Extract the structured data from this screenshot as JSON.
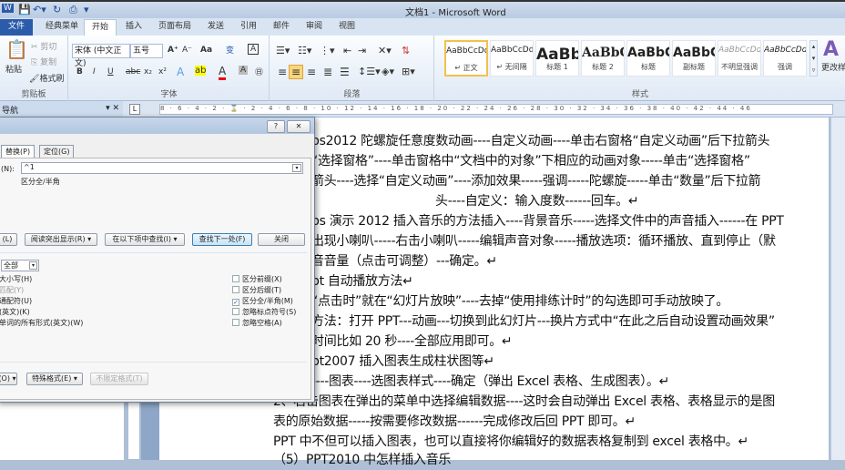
{
  "window": {
    "title": "文档1 - Microsoft Word"
  },
  "ribbon_tabs": [
    "文件",
    "经典菜单",
    "开始",
    "插入",
    "页面布局",
    "发送",
    "引用",
    "邮件",
    "审阅",
    "视图"
  ],
  "active_tab": "开始",
  "clipboard": {
    "paste": "粘贴",
    "cut": "剪切",
    "copy": "复制",
    "format_painter": "格式刷",
    "label": "剪贴板"
  },
  "font": {
    "name": "宋体 (中文正文)",
    "size": "五号",
    "label": "字体",
    "bold": "B",
    "italic": "I",
    "underline": "U",
    "strike": "abc",
    "sub": "x₂",
    "sup": "x²",
    "grow": "A⁺",
    "shrink": "A⁻",
    "case": "Aa"
  },
  "paragraph": {
    "label": "段落"
  },
  "styles": {
    "label": "样式",
    "change": "更改样式",
    "items": [
      {
        "sample": "AaBbCcDd",
        "name": "↵ 正文"
      },
      {
        "sample": "AaBbCcDd",
        "name": "↵ 无间隔"
      },
      {
        "sample": "AaBb",
        "name": "标题 1"
      },
      {
        "sample": "AaBbC",
        "name": "标题 2"
      },
      {
        "sample": "AaBbC",
        "name": "标题"
      },
      {
        "sample": "AaBbC",
        "name": "副标题"
      },
      {
        "sample": "AaBbCcDd",
        "name": "不明显强调"
      },
      {
        "sample": "AaBbCcDd",
        "name": "强调"
      }
    ]
  },
  "nav": {
    "title": "导航"
  },
  "ruler": {
    "text": "8 · 6 · 4 · 2 · ⌛ · 2 · 4 · 6 · 8 · 10 · 12 · 14 · 16 · 18 · 20 · 22 · 24 · 26 · 28 · 30 · 32 · 34 · 36 · 38 · 40 · 42 · 44 · 46"
  },
  "dialog": {
    "help": "?",
    "close_x": "✕",
    "tabs": [
      "替换(P)",
      "定位(G)"
    ],
    "find_label": "(N):",
    "find_value": "^1",
    "find_note": "区分全/半角",
    "buttons": {
      "more": "(L)",
      "reading_highlight": "阅读突出显示(R) ▾",
      "find_in": "在以下项中查找(I) ▾",
      "find_next": "查找下一处(F)",
      "close": "关闭"
    },
    "search_dir": "全部",
    "left_opts": [
      "大小写(H)",
      "匹配(Y)",
      "通配符(U)",
      "(英文)(K)",
      "单词的所有形式(英文)(W)"
    ],
    "right_opts": [
      {
        "label": "区分前缀(X)",
        "checked": false
      },
      {
        "label": "区分后缀(T)",
        "checked": false
      },
      {
        "label": "区分全/半角(M)",
        "checked": true
      },
      {
        "label": "忽略标点符号(S)",
        "checked": false
      },
      {
        "label": "忽略空格(A)",
        "checked": false
      }
    ],
    "bottom": {
      "format": "(O) ▾",
      "special": "特殊格式(E) ▾",
      "no_format": "不限定格式(T)"
    }
  },
  "document": {
    "lines": [
      "ps2012 陀螺旋任意度数动画----自定义动画----单击右窗格“自定义动画”后下拉箭头",
      "“选择窗格”----单击窗格中“文档中的对象”下相应的动画对象-----单击“选择窗格”",
      "箭头----选择“自定义动画”----添加效果-----强调-----陀螺旋-----单击“数量”后下拉箭",
      "头----自定义：输入度数------回车。↵",
      "ps 演示 2012 插入音乐的方法插入----背景音乐-----选择文件中的声音插入------在 PPT",
      "出现小喇叭-----右击小喇叭-----编辑声音对象-----播放选项：循环播放、直到停止（默",
      "音音量（点击可调整）---确定。↵",
      "pt 自动播放方法↵",
      "“点击时”就在“幻灯片放映”----去掉“使用排练计时”的勾选即可手动放映了。",
      "方法：打开 PPT---动画---切换到此幻灯片---换片方式中“在此之后自动设置动画效果”",
      "时间比如 20 秒----全部应用即可。↵",
      "pt2007 插入图表生成柱状图等↵",
      "----图表----选图表样式----确定（弹出 Excel 表格、生成图表）。↵",
      "2、右击图表在弹出的菜单中选择编辑数据----这时会自动弹出 Excel 表格、表格显示的是图",
      "表的原始数据-----按需要修改数据------完成修改后回 PPT 即可。↵",
      "PPT 中不但可以插入图表，也可以直接将你编辑好的数据表格复制到 excel 表格中。↵",
      "（5）PPT2010 中怎样插入音乐"
    ]
  }
}
